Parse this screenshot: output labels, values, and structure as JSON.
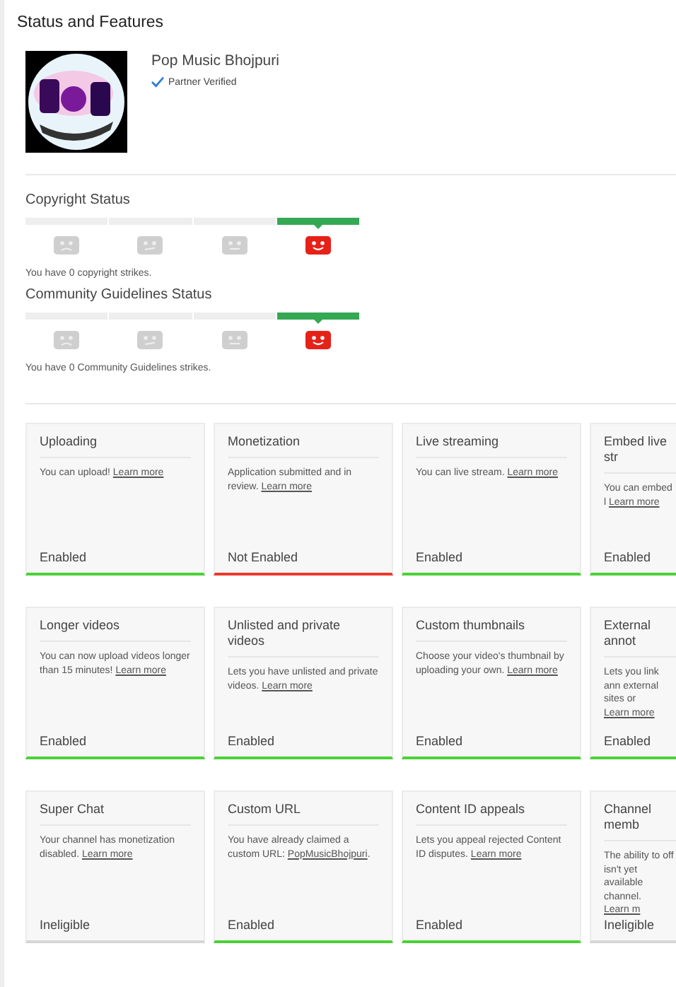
{
  "title": "Status and Features",
  "channel": {
    "name": "Pop Music Bhojpuri",
    "badge": "Partner Verified",
    "verified": true
  },
  "strike_sections": [
    {
      "title": "Copyright Status",
      "segments": [
        {
          "kind": "sad",
          "selected": false
        },
        {
          "kind": "meh",
          "selected": false
        },
        {
          "kind": "neutral",
          "selected": false
        },
        {
          "kind": "happy",
          "selected": true
        }
      ],
      "note": "You have 0 copyright strikes."
    },
    {
      "title": "Community Guidelines Status",
      "segments": [
        {
          "kind": "sad",
          "selected": false
        },
        {
          "kind": "meh",
          "selected": false
        },
        {
          "kind": "neutral",
          "selected": false
        },
        {
          "kind": "happy",
          "selected": true
        }
      ],
      "note": "You have 0 Community Guidelines strikes."
    }
  ],
  "features": [
    [
      {
        "title": "Uploading",
        "text": "You can upload! ",
        "link": "Learn more",
        "status": "Enabled",
        "kind": "enabled"
      },
      {
        "title": "Monetization",
        "text": "Application submitted and in review. ",
        "link": "Learn more",
        "status": "Not Enabled",
        "kind": "disabled"
      },
      {
        "title": "Live streaming",
        "text": "You can live stream. ",
        "link": "Learn more",
        "status": "Enabled",
        "kind": "enabled"
      },
      {
        "title": "Embed live str",
        "text": "You can embed l ",
        "link": "Learn more",
        "status": "Enabled",
        "kind": "enabled"
      }
    ],
    [
      {
        "title": "Longer videos",
        "text": "You can now upload videos longer than 15 minutes! ",
        "link": "Learn more",
        "status": "Enabled",
        "kind": "enabled"
      },
      {
        "title": "Unlisted and private videos",
        "text": "Lets you have unlisted and private videos. ",
        "link": "Learn more",
        "status": "Enabled",
        "kind": "enabled"
      },
      {
        "title": "Custom thumbnails",
        "text": "Choose your video's thumbnail by uploading your own. ",
        "link": "Learn more",
        "status": "Enabled",
        "kind": "enabled"
      },
      {
        "title": "External annot",
        "text": "Lets you link ann external sites or ",
        "link": "Learn more",
        "status": "Enabled",
        "kind": "enabled"
      }
    ],
    [
      {
        "title": "Super Chat",
        "text": "Your channel has monetization disabled. ",
        "link": "Learn more",
        "status": "Ineligible",
        "kind": "ineligible"
      },
      {
        "title": "Custom URL",
        "text": "You have already claimed a custom URL: ",
        "link": "PopMusicBhojpuri",
        "after": ".",
        "status": "Enabled",
        "kind": "enabled"
      },
      {
        "title": "Content ID appeals",
        "text": "Lets you appeal rejected Content ID disputes. ",
        "link": "Learn more",
        "status": "Enabled",
        "kind": "enabled"
      },
      {
        "title": "Channel memb",
        "text": "The ability to off isn't yet available channel. ",
        "link": "Learn m",
        "status": "Ineligible",
        "kind": "ineligible"
      }
    ]
  ]
}
